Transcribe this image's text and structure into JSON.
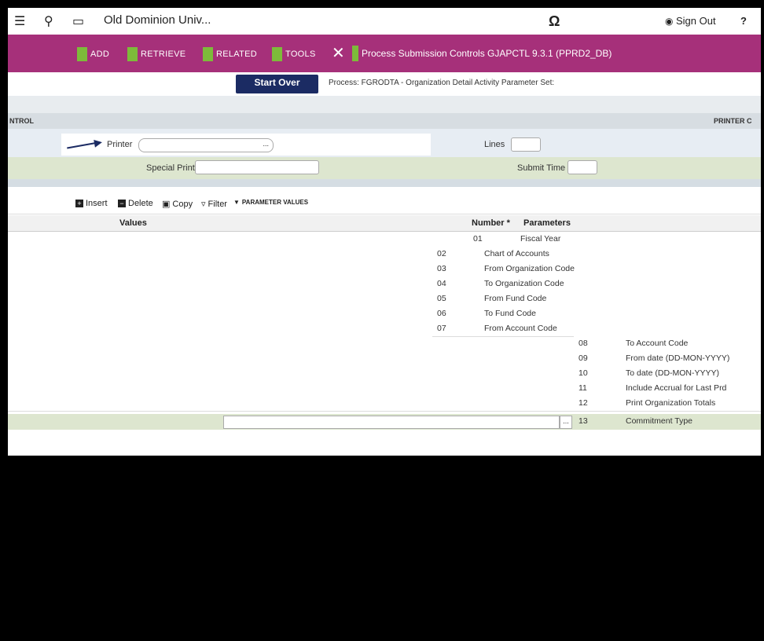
{
  "topbar": {
    "title": "Old Dominion Univ...",
    "sign_out": "Sign Out",
    "help": "?"
  },
  "toolbar": {
    "items": [
      "ADD",
      "RETRIEVE",
      "RELATED",
      "TOOLS"
    ],
    "process_title": "Process Submission Controls GJAPCTL 9.3.1 (PPRD2_DB)"
  },
  "actions": {
    "start_over": "Start Over",
    "process_line": "Process: FGRODTA - Organization Detail Activity  Parameter Set:"
  },
  "section": {
    "left": "NTROL",
    "right": "PRINTER C"
  },
  "printer": {
    "printer_label": "Printer",
    "lines_label": "Lines",
    "special_print_label": "Special Print",
    "submit_time_label": "Submit Time",
    "picker": "..."
  },
  "params_toolbar": {
    "insert": "Insert",
    "delete": "Delete",
    "copy": "Copy",
    "filter": "Filter",
    "section_title": "PARAMETER VALUES"
  },
  "values_table": {
    "header": "Values"
  },
  "parameters_table": {
    "header_number": "Number *",
    "header_param": "Parameters",
    "rows": [
      {
        "number": "01",
        "name": "Fiscal Year"
      },
      {
        "number": "02",
        "name": "Chart of Accounts"
      },
      {
        "number": "03",
        "name": "From Organization Code"
      },
      {
        "number": "04",
        "name": "To Organization Code"
      },
      {
        "number": "05",
        "name": "From Fund Code"
      },
      {
        "number": "06",
        "name": "To Fund Code"
      },
      {
        "number": "07",
        "name": "From Account Code"
      },
      {
        "number": "08",
        "name": "To Account Code"
      },
      {
        "number": "09",
        "name": "From date (DD-MON-YYYY)"
      },
      {
        "number": "10",
        "name": "To date (DD-MON-YYYY)"
      },
      {
        "number": "11",
        "name": "Include Accrual for Last Prd"
      },
      {
        "number": "12",
        "name": "Print Organization Totals"
      },
      {
        "number": "13",
        "name": "Commitment Type"
      }
    ]
  },
  "bottom": {
    "picker": "..."
  },
  "colors": {
    "toolbar": "#a6307a",
    "accent_green": "#7dbb3a",
    "start_over": "#1b2b63"
  }
}
